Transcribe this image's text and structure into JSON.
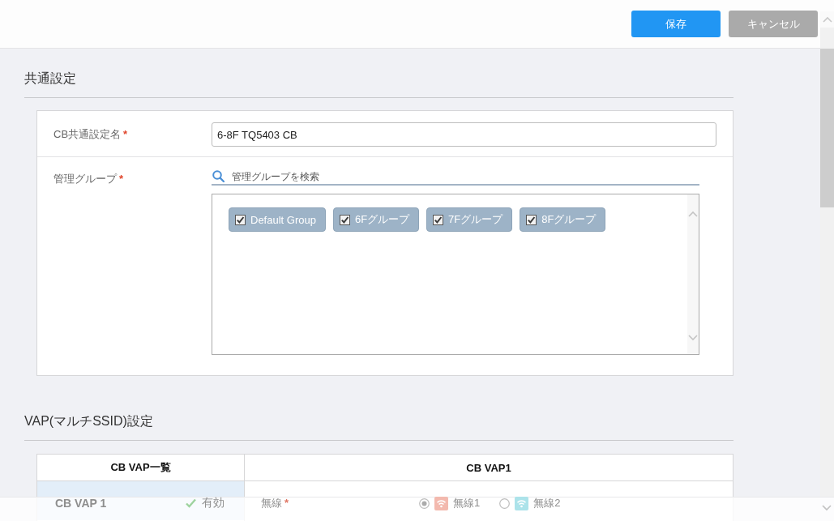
{
  "header": {
    "buttons": [
      {
        "label": "保存",
        "kind": "primary"
      },
      {
        "label": "キャンセル",
        "kind": "secondary"
      }
    ]
  },
  "common_settings": {
    "title": "共通設定",
    "fields": [
      {
        "kind": "text",
        "label": "CB共通設定名",
        "required_mark": "*",
        "value": "6-8F TQ5403 CB"
      },
      {
        "kind": "group_picker",
        "label": "管理グループ",
        "required_mark": "*",
        "search": {
          "placeholder": "管理グループを検索"
        },
        "groups": [
          {
            "label": "Default Group",
            "checked": true
          },
          {
            "label": "6Fグループ",
            "checked": true
          },
          {
            "label": "7Fグループ",
            "checked": true
          },
          {
            "label": "8Fグループ",
            "checked": true
          }
        ]
      }
    ]
  },
  "vap_settings": {
    "title": "VAP(マルチSSID)設定",
    "list": {
      "heading": "CB VAP一覧",
      "items": [
        {
          "name": "CB VAP 1",
          "status": "有効",
          "selected": true
        }
      ]
    },
    "detail": {
      "heading": "CB VAP1",
      "fields": [
        {
          "label": "無線",
          "required_mark": "*",
          "options": [
            {
              "label": "無線1",
              "selected": true,
              "color": "#f3b9ae"
            },
            {
              "label": "無線2",
              "selected": false,
              "color": "#ace3ea"
            }
          ]
        }
      ]
    }
  }
}
